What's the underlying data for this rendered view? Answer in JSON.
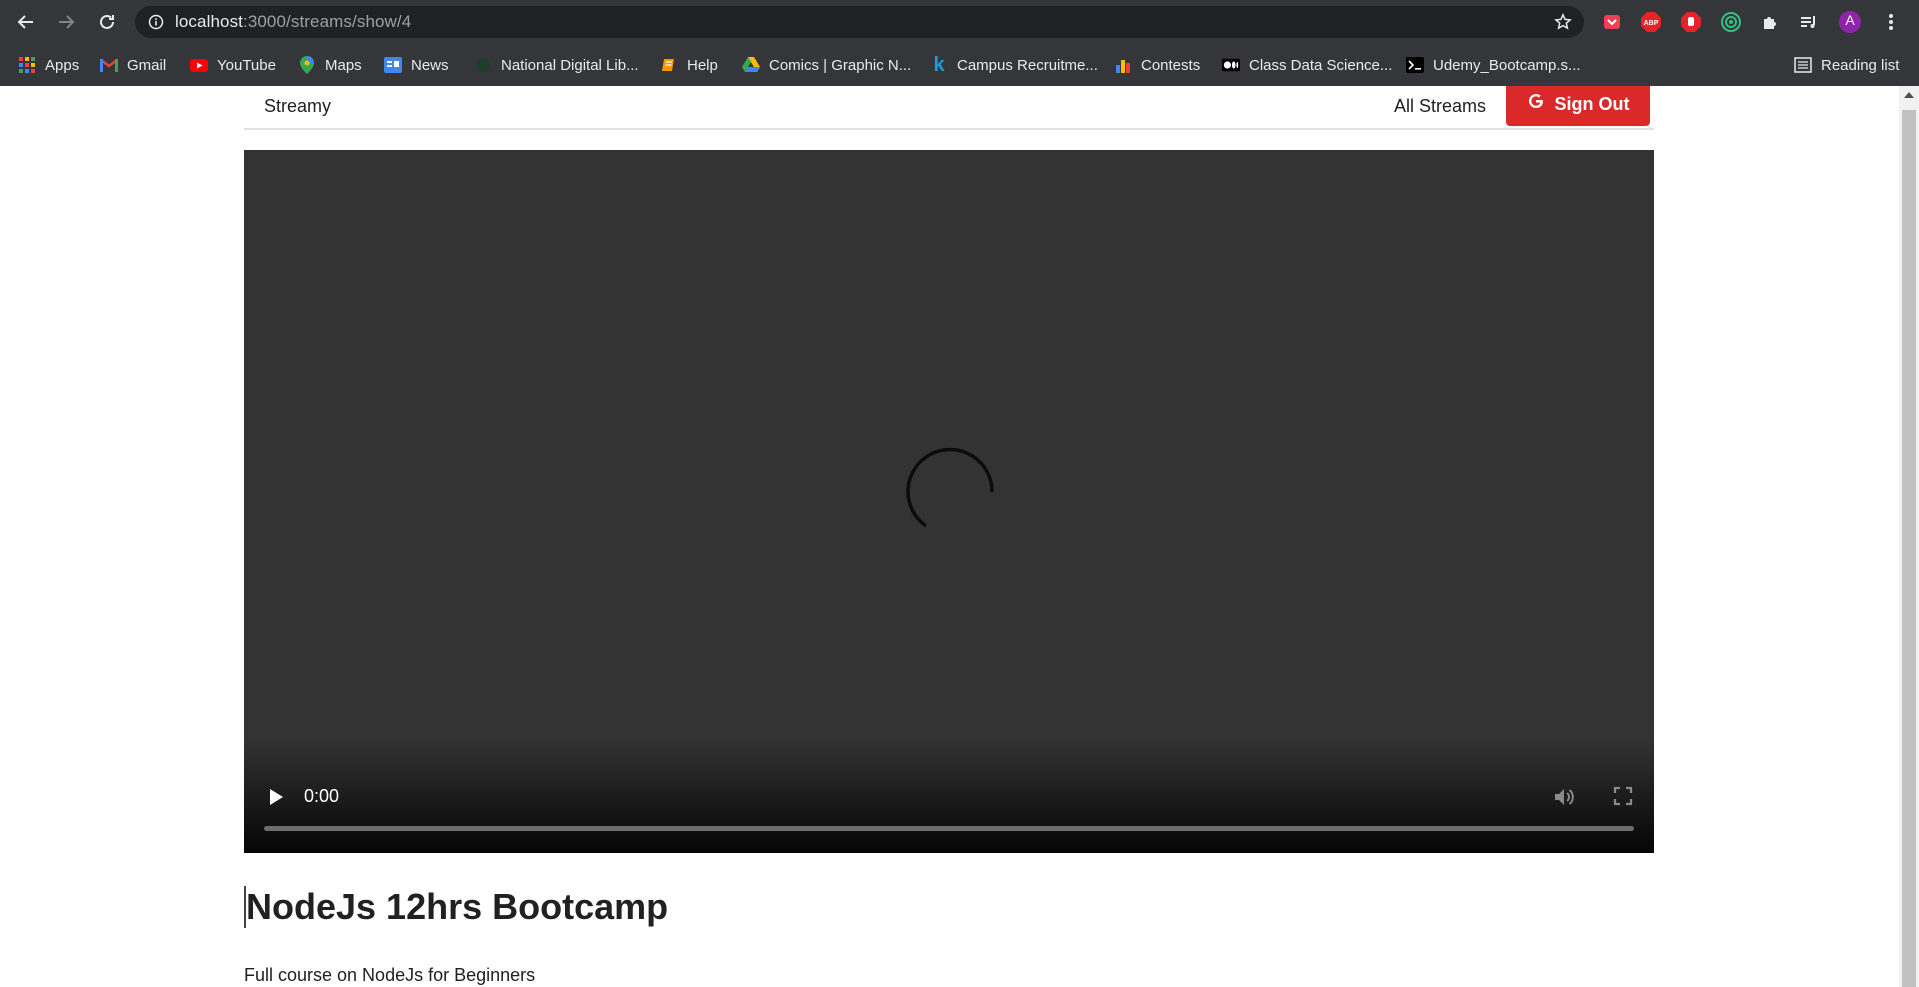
{
  "browser": {
    "url_host": "localhost",
    "url_path": ":3000/streams/show/4",
    "profile_initial": "A",
    "reading_list": "Reading list"
  },
  "bookmarks": [
    {
      "label": "Apps",
      "icon": "apps-grid-icon"
    },
    {
      "label": "Gmail",
      "icon": "gmail-icon"
    },
    {
      "label": "YouTube",
      "icon": "youtube-icon"
    },
    {
      "label": "Maps",
      "icon": "maps-icon"
    },
    {
      "label": "News",
      "icon": "news-icon"
    },
    {
      "label": "National Digital Lib...",
      "icon": "library-icon"
    },
    {
      "label": "Help",
      "icon": "help-book-icon"
    },
    {
      "label": "Comics | Graphic N...",
      "icon": "drive-icon"
    },
    {
      "label": "Campus Recruitme...",
      "icon": "k-icon"
    },
    {
      "label": "Contests",
      "icon": "bar-chart-icon"
    },
    {
      "label": "Class Data Science...",
      "icon": "medium-icon"
    },
    {
      "label": "Udemy_Bootcamp.s...",
      "icon": "terminal-icon"
    }
  ],
  "nav": {
    "brand": "Streamy",
    "all_streams": "All Streams",
    "sign_out": "Sign Out"
  },
  "player": {
    "time": "0:00",
    "progress": 0
  },
  "stream": {
    "title": "NodeJs 12hrs Bootcamp",
    "description": "Full course on NodeJs for Beginners"
  },
  "colors": {
    "signout_bg": "#db2828",
    "chrome_bg": "#35363a",
    "video_bg": "#333333"
  }
}
